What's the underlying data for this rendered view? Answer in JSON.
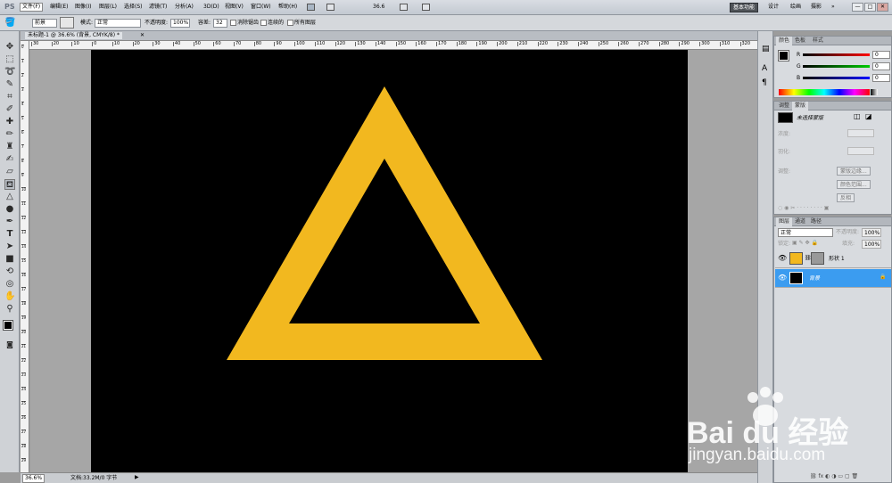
{
  "app": {
    "logo": "PS"
  },
  "menu": {
    "items": [
      "文件(F)",
      "编辑(E)",
      "图像(I)",
      "图层(L)",
      "选择(S)",
      "滤镜(T)",
      "分析(A)",
      "3D(D)",
      "视图(V)",
      "窗口(W)",
      "帮助(H)"
    ]
  },
  "header": {
    "zoom": "36.6",
    "workspaces": [
      "基本功能",
      "设计",
      "绘画",
      "摄影"
    ],
    "active_workspace": "基本功能",
    "window_controls": [
      "—",
      "□",
      "✕"
    ]
  },
  "options": {
    "fill_source": "前景",
    "mode_label": "模式:",
    "mode_value": "正常",
    "opacity_label": "不透明度:",
    "opacity_value": "100%",
    "tolerance_label": "容差:",
    "tolerance_value": "32",
    "antialias_label": "消除锯齿",
    "contiguous_label": "连续的",
    "all_layers_label": "所有图层"
  },
  "document": {
    "tab_title": "未标题-1 @ 36.6% (背景, CMYK/8) *",
    "ruler_top": [
      "30",
      "20",
      "10",
      "0",
      "10",
      "20",
      "30",
      "40",
      "50",
      "60",
      "70",
      "80",
      "90",
      "100",
      "110",
      "120",
      "130",
      "140",
      "150",
      "160",
      "170",
      "180",
      "190",
      "200",
      "210",
      "220",
      "230",
      "240",
      "250",
      "260",
      "270",
      "280",
      "290",
      "300",
      "310",
      "320",
      "330"
    ],
    "ruler_left": [
      "0",
      "1",
      "2",
      "3",
      "4",
      "5",
      "6",
      "7",
      "8",
      "9",
      "10",
      "11",
      "12",
      "13",
      "14",
      "15",
      "16",
      "17",
      "18",
      "19",
      "20",
      "21",
      "22",
      "23",
      "24",
      "25",
      "26",
      "27",
      "28",
      "29"
    ],
    "triangle_color": "#f2b81f",
    "canvas_color": "#000000"
  },
  "status": {
    "zoom": "36.6%",
    "doc_info": "文档:33.2M/0 字节"
  },
  "color_panel": {
    "tabs": [
      "颜色",
      "色板",
      "样式"
    ],
    "channels": [
      {
        "label": "R",
        "value": "0"
      },
      {
        "label": "G",
        "value": "0"
      },
      {
        "label": "B",
        "value": "0"
      }
    ]
  },
  "masks_panel": {
    "tabs": [
      "调整",
      "蒙版"
    ],
    "status": "未选择蒙版",
    "density_label": "浓度:",
    "feather_label": "羽化:",
    "refine_label": "调整:",
    "buttons": [
      "蒙版边缘...",
      "颜色范围...",
      "反相"
    ]
  },
  "layers_panel": {
    "tabs": [
      "图层",
      "通道",
      "路径"
    ],
    "blend_mode": "正常",
    "opacity_label": "不透明度:",
    "opacity_value": "100%",
    "lock_label": "锁定:",
    "fill_label": "填充:",
    "fill_value": "100%",
    "layers": [
      {
        "name": "形状 1",
        "thumb_color": "#f2b81f",
        "selected": false
      },
      {
        "name": "背景",
        "thumb_color": "#000000",
        "selected": true
      }
    ]
  },
  "watermark": {
    "brand": "Bai du 经验",
    "url": "jingyan.baidu.com"
  }
}
